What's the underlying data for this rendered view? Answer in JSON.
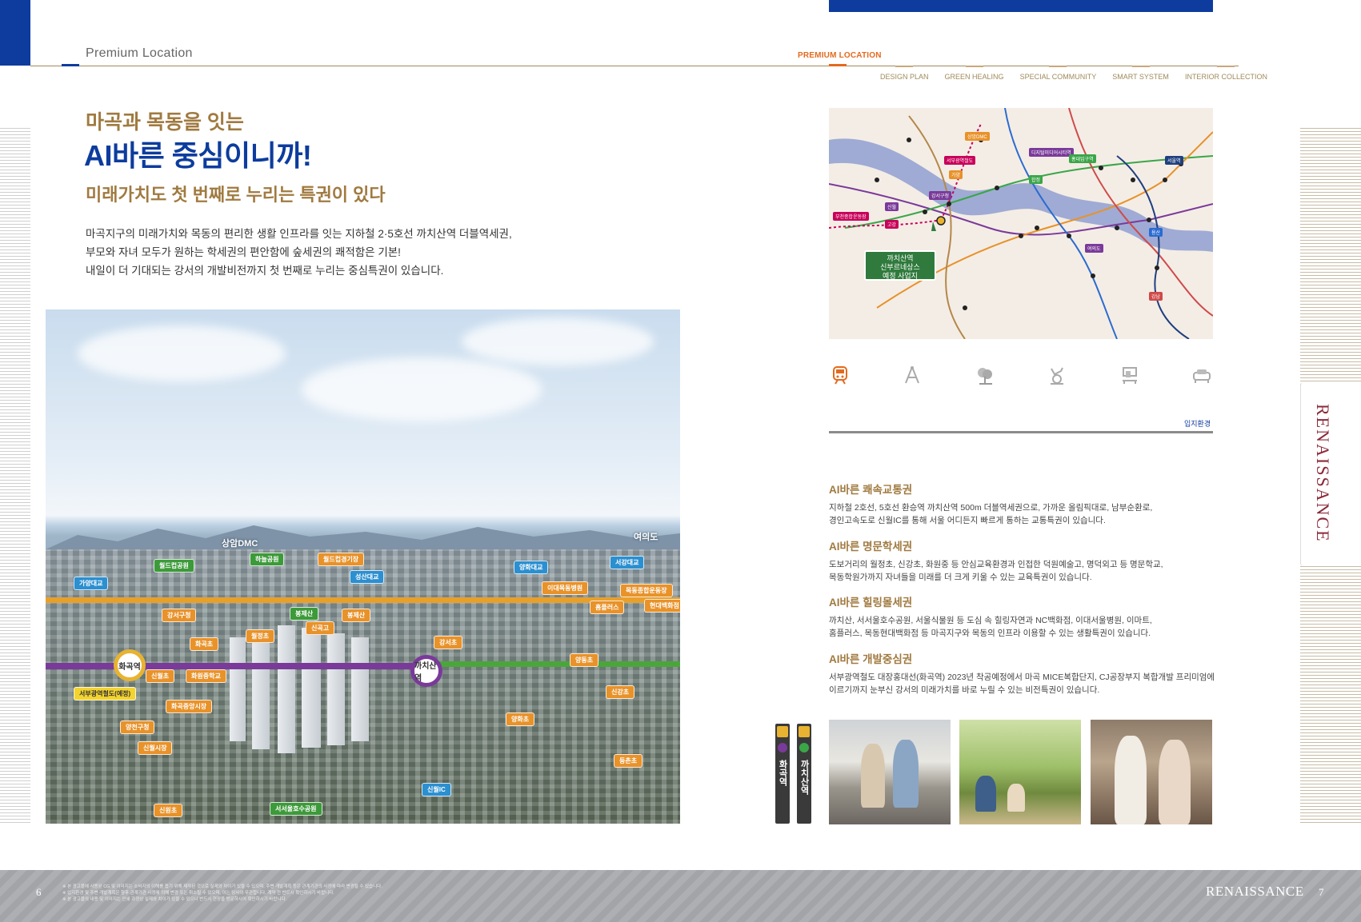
{
  "header": {
    "section_title": "Premium Location",
    "active_tab": "PREMIUM LOCATION",
    "tabs": [
      "DESIGN PLAN",
      "GREEN HEALING",
      "SPECIAL COMMUNITY",
      "SMART SYSTEM",
      "INTERIOR COLLECTION"
    ]
  },
  "side_tab": "RENAISSANCE",
  "left": {
    "heading_1": "마곡과 목동을 잇는",
    "heading_2": "AI바른 중심이니까!",
    "heading_3": "미래가치도 첫 번째로 누리는 특권이 있다",
    "paragraph": [
      "마곡지구의 미래가치와 목동의 편리한 생활 인프라를 잇는 지하철 2·5호선 까치산역 더블역세권,",
      "부모와 자녀 모두가 원하는 학세권의 편안함에 숲세권의 쾌적함은 기본!",
      "내일이 더 기대되는 강서의 개발비전까지 첫 번째로 누리는 중심특권이 있습니다."
    ]
  },
  "aerial": {
    "stations": [
      "화곡역",
      "까치산역"
    ],
    "labels_orange": [
      "강서구청",
      "화곡초",
      "신월초",
      "화원중학교",
      "화곡중앙시장",
      "월정초",
      "신월시장",
      "신원초",
      "봉제산",
      "신곡고",
      "양동초",
      "강서초",
      "신강초",
      "양화초",
      "목동종합운동장",
      "현대백화점",
      "홈플러스",
      "이대목동병원",
      "등촌초",
      "양천구청"
    ],
    "labels_green": [
      "월드컵공원",
      "하늘공원",
      "월드컵경기장",
      "서서울호수공원",
      "봉제산"
    ],
    "labels_blue": [
      "가양대교",
      "성산대교",
      "양화대교",
      "서강대교",
      "신월IC"
    ],
    "label_yellow": "서부광역철도(예정)",
    "landmarks": [
      "상암DMC",
      "여의도"
    ]
  },
  "map": {
    "callout": [
      "까치산역",
      "신부르네상스",
      "예정 사업지"
    ],
    "legend_stations": [
      "서부광역철도",
      "상암DMC",
      "디지털미디어시티역",
      "가양",
      "강서구청",
      "신월",
      "고강",
      "부천종합운동장",
      "홍대입구역",
      "합정",
      "당산",
      "여의도",
      "용산",
      "서울역",
      "시청",
      "종로",
      "강남",
      "잠실",
      "사당",
      "양재"
    ]
  },
  "icons": [
    "subway-icon",
    "compass-icon",
    "tree-icon",
    "exercise-bike-icon",
    "desk-icon",
    "sofa-icon"
  ],
  "env_label": "입지환경",
  "features": [
    {
      "title": "AI바른 쾌속교통권",
      "lines": [
        "지하철 2호선, 5호선 환승역 까치산역 500m 더블역세권으로, 가까운 올림픽대로, 남부순환로,",
        "경인고속도로 신월IC를 통해 서울 어디든지 빠르게 통하는 교통특권이 있습니다."
      ]
    },
    {
      "title": "AI바른 명문학세권",
      "lines": [
        "도보거리의 월정초, 신강초, 화원중 등 안심교육환경과 인접한 덕원예술고, 명덕외고 등 명문학교,",
        "목동학원가까지 자녀들을 미래를 더 크게 키울 수 있는 교육특권이 있습니다."
      ]
    },
    {
      "title": "AI바른 힐링몰세권",
      "lines": [
        "까치산, 서서울호수공원, 서울식물원 등 도심 속 힐링자연과 NC백화점, 이대서울병원, 이마트,",
        "홈플러스, 목동현대백화점 등 마곡지구와 목동의 인프라 이용할 수 있는 생활특권이 있습니다."
      ]
    },
    {
      "title": "AI바른 개발중심권",
      "lines": [
        "서부광역철도 대장홍대선(화곡역) 2023년 착공예정에서 마곡 MICE복합단지, CJ공장부지 복합개발 프리미엄에",
        "이르기까지 눈부신 강서의 미래가치를 바로 누릴 수 있는 비전특권이 있습니다."
      ]
    }
  ],
  "station_tags": [
    {
      "name": "화곡역",
      "line": "5호선",
      "color": "#7a3a9a"
    },
    {
      "name": "까치산역",
      "line": "2호선·5호선",
      "color": "#3aa648"
    }
  ],
  "footer": {
    "page_left": "6",
    "page_right": "7",
    "brand": "RENAISSANCE",
    "notes": [
      "※ 본 광고물에 사용된 CG 및 이미지는 소비자의 이해를 돕기 위해 제작된 것으로 실제와 차이가 있을 수 있으며, 주변 개발계획 등은 관계기관의 사정에 따라 변경될 수 있습니다.",
      "※ 입지환경 및 주변 개발계획은 향후 관계기관 사정에 의해 변경 또는 취소될 수 있으며, 이는 당사와 무관합니다. 계약 전 반드시 확인하시기 바랍니다.",
      "※ 본 광고물의 내용 및 이미지는 인쇄 과정상 실제와 차이가 있을 수 있으니 반드시 현장을 방문하시어 확인하시기 바랍니다."
    ]
  },
  "colors": {
    "brand_blue": "#0d3c9e",
    "gold": "#a07a40",
    "accent_orange": "#e36a1e",
    "renaissance_red": "#8a2838"
  }
}
